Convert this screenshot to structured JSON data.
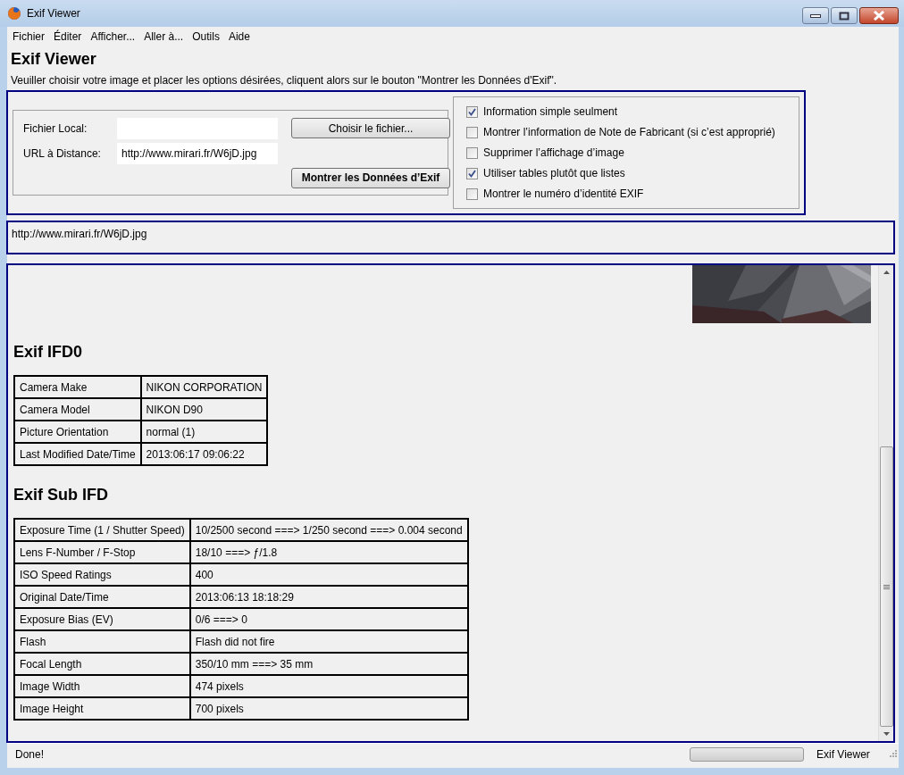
{
  "window": {
    "title": "Exif Viewer"
  },
  "menu": [
    {
      "label": "Fichier"
    },
    {
      "label": "Éditer"
    },
    {
      "label": "Afficher..."
    },
    {
      "label": "Aller à..."
    },
    {
      "label": "Outils"
    },
    {
      "label": "Aide"
    }
  ],
  "heading": "Exif Viewer",
  "instructions": "Veuiller choisir votre image et placer les options désirées, cliquent alors sur le bouton \"Montrer les Données d'Exif\".",
  "local_file": {
    "label": "Fichier Local:"
  },
  "remote_url": {
    "label": "URL à Distance:",
    "value": "http://www.mirari.fr/W6jD.jpg"
  },
  "buttons": {
    "choose": "Choisir le fichier...",
    "show": "Montrer les Données d’Exif"
  },
  "options": [
    {
      "label": "Information simple seulment",
      "checked": true
    },
    {
      "label": "Montrer l’information de Note de Fabricant (si c’est approprié)",
      "checked": false
    },
    {
      "label": "Supprimer l’affichage d’image",
      "checked": false
    },
    {
      "label": "Utiliser tables plutôt que listes",
      "checked": true
    },
    {
      "label": "Montrer le numéro d’identité EXIF",
      "checked": false
    }
  ],
  "url_display": "http://www.mirari.fr/W6jD.jpg",
  "results": {
    "sections": [
      {
        "title": "Exif IFD0",
        "rows": [
          {
            "tag": "Camera Make",
            "value": "NIKON CORPORATION"
          },
          {
            "tag": "Camera Model",
            "value": "NIKON D90"
          },
          {
            "tag": "Picture Orientation",
            "value": "normal (1)"
          },
          {
            "tag": "Last Modified Date/Time",
            "value": "2013:06:17 09:06:22"
          }
        ]
      },
      {
        "title": "Exif Sub IFD",
        "rows": [
          {
            "tag": "Exposure Time (1 / Shutter Speed)",
            "value": "10/2500 second ===> 1/250 second ===> 0.004 second"
          },
          {
            "tag": "Lens F-Number / F-Stop",
            "value": "18/10 ===> ƒ/1.8"
          },
          {
            "tag": "ISO Speed Ratings",
            "value": "400"
          },
          {
            "tag": "Original Date/Time",
            "value": "2013:06:13 18:18:29"
          },
          {
            "tag": "Exposure Bias (EV)",
            "value": "0/6 ===> 0"
          },
          {
            "tag": "Flash",
            "value": "Flash did not fire"
          },
          {
            "tag": "Focal Length",
            "value": "350/10 mm ===> 35 mm"
          },
          {
            "tag": "Image Width",
            "value": "474 pixels"
          },
          {
            "tag": "Image Height",
            "value": "700 pixels"
          }
        ]
      }
    ]
  },
  "status_bar": {
    "message": "Done!",
    "progress": {
      "level": 0
    },
    "app_name": "Exif Viewer"
  }
}
